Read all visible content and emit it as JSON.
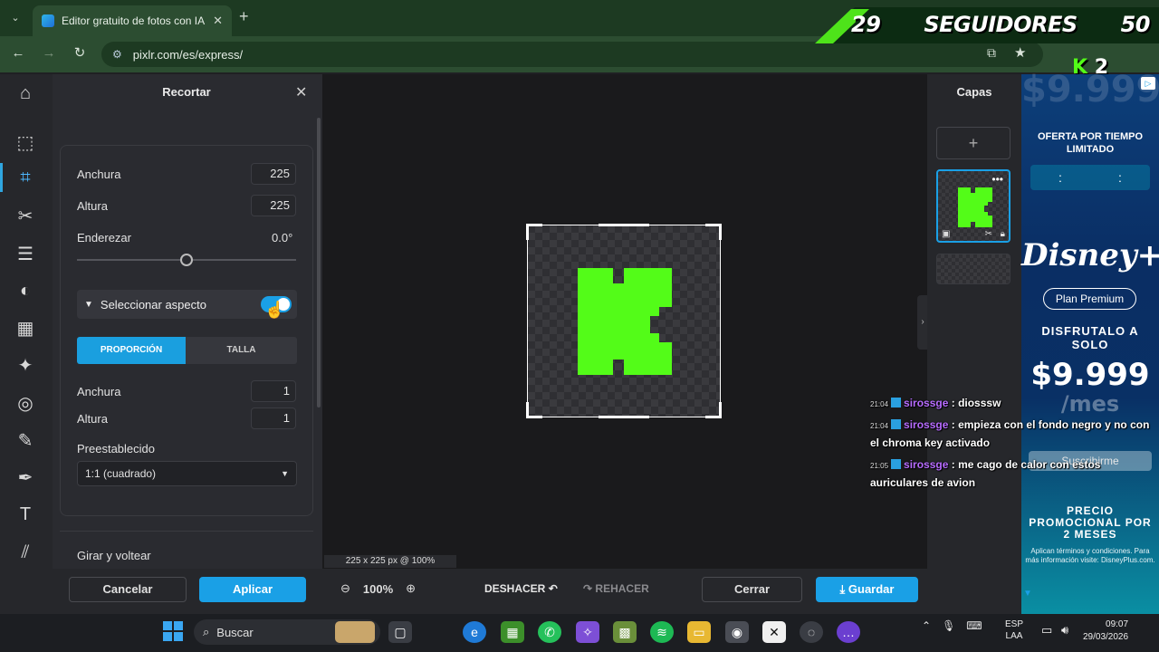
{
  "browser": {
    "tab_title": "Editor gratuito de fotos con IA",
    "url": "pixlr.com/es/express/"
  },
  "overlay": {
    "banner_left": "29",
    "banner_center": "SEGUIDORES",
    "banner_right": "50",
    "logo_letter": "K",
    "logo_count": "2"
  },
  "crop_panel": {
    "title": "Recortar",
    "width_label": "Anchura",
    "width_value": "225",
    "height_label": "Altura",
    "height_value": "225",
    "straighten_label": "Enderezar",
    "straighten_value": "0.0°",
    "aspect_label": "Seleccionar aspecto",
    "segment_ratio": "PROPORCIÓN",
    "segment_size": "TALLA",
    "ratio_width_label": "Anchura",
    "ratio_width_value": "1",
    "ratio_height_label": "Altura",
    "ratio_height_value": "1",
    "preset_label": "Preestablecido",
    "preset_value": "1:1 (cuadrado)",
    "rotate_label": "Girar y voltear"
  },
  "canvas": {
    "size_info": "225 x 225 px @ 100%",
    "logo_color": "#53fc18"
  },
  "layers": {
    "title": "Capas"
  },
  "bottom": {
    "cancel": "Cancelar",
    "apply": "Aplicar",
    "zoom": "100%",
    "undo": "DESHACER",
    "redo": "REHACER",
    "close": "Cerrar",
    "save": "Guardar"
  },
  "ad": {
    "bg_price": "$9.999",
    "offer": "OFERTA POR TIEMPO LIMITADO",
    "brand": "Disney+",
    "plan": "Plan Premium",
    "enjoy": "DISFRUTALO A SOLO",
    "price": "$9.999",
    "per": "/mes",
    "subscribe": "Suscribirme",
    "promo": "PRECIO PROMOCIONAL POR 2 MESES",
    "legal": "Aplican términos y condiciones. Para más información visite: DisneyPlus.com."
  },
  "chat": [
    {
      "time": "21:04",
      "user": "sirossge",
      "text": ": diosssw"
    },
    {
      "time": "21:04",
      "user": "sirossge",
      "text": ": empieza con el fondo negro y no con el chroma key activado"
    },
    {
      "time": "21:05",
      "user": "sirossge",
      "text": ": me cago de calor con estos auriculares de avion"
    }
  ],
  "taskbar": {
    "search": "Buscar",
    "lang_1": "ESP",
    "lang_2": "LAA",
    "time": "09:07",
    "date": "29/03/2026"
  },
  "colors": {
    "accent": "#1aa0e6",
    "kick_green": "#53fc18",
    "browser_green": "#2c4d31"
  }
}
